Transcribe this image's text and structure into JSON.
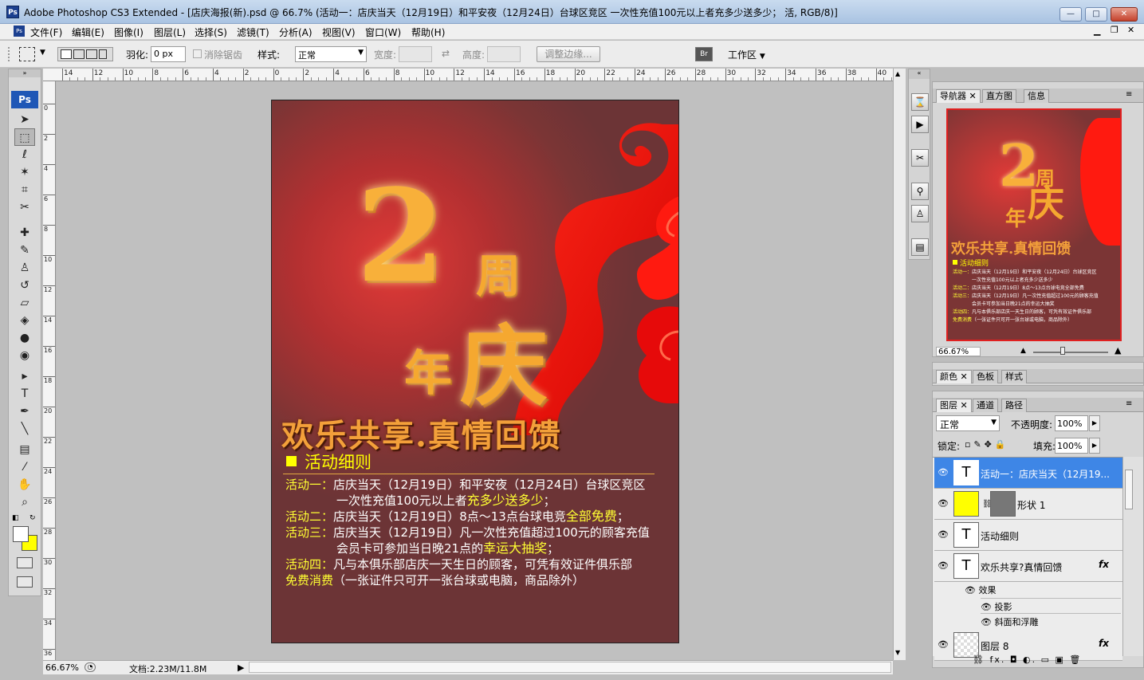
{
  "window": {
    "app_icon": "Ps",
    "title": "Adobe Photoshop CS3 Extended - [店庆海报(新).psd @ 66.7% (活动一：店庆当天（12月19日）和平安夜（12月24日）台球区竞区        一次性充值100元以上者充多少送多少； 活, RGB/8)]",
    "minimize": "—",
    "maximize": "□",
    "close": "✕"
  },
  "menubar": {
    "items": [
      "文件(F)",
      "编辑(E)",
      "图像(I)",
      "图层(L)",
      "选择(S)",
      "滤镜(T)",
      "分析(A)",
      "视图(V)",
      "窗口(W)",
      "帮助(H)"
    ],
    "doc_min": "▁",
    "doc_restore": "❐",
    "doc_close": "✕"
  },
  "options": {
    "feather_label": "羽化:",
    "feather_value": "0 px",
    "antialias_label": "消除锯齿",
    "style_label": "样式:",
    "style_value": "正常",
    "width_label": "宽度:",
    "height_label": "高度:",
    "refine_edge": "调整边缘...",
    "workspace": "工作区"
  },
  "toolbox": {
    "logo": "Ps",
    "tools": [
      {
        "name": "move-tool",
        "glyph": "➤"
      },
      {
        "name": "marquee-tool",
        "glyph": "⬚"
      },
      {
        "name": "lasso-tool",
        "glyph": "ℓ"
      },
      {
        "name": "magic-wand-tool",
        "glyph": "✶"
      },
      {
        "name": "crop-tool",
        "glyph": "⌗"
      },
      {
        "name": "slice-tool",
        "glyph": "✂"
      },
      {
        "name": "healing-brush-tool",
        "glyph": "✚"
      },
      {
        "name": "brush-tool",
        "glyph": "✎"
      },
      {
        "name": "clone-stamp-tool",
        "glyph": "♙"
      },
      {
        "name": "history-brush-tool",
        "glyph": "↺"
      },
      {
        "name": "eraser-tool",
        "glyph": "▱"
      },
      {
        "name": "paint-bucket-tool",
        "glyph": "◈"
      },
      {
        "name": "blur-tool",
        "glyph": "●"
      },
      {
        "name": "dodge-tool",
        "glyph": "◉"
      },
      {
        "name": "path-selection-tool",
        "glyph": "▸"
      },
      {
        "name": "type-tool",
        "glyph": "T"
      },
      {
        "name": "pen-tool",
        "glyph": "✒"
      },
      {
        "name": "line-tool",
        "glyph": "╲"
      },
      {
        "name": "notes-tool",
        "glyph": "▤"
      },
      {
        "name": "eyedropper-tool",
        "glyph": "⁄"
      },
      {
        "name": "hand-tool",
        "glyph": "✋"
      },
      {
        "name": "zoom-tool",
        "glyph": "⌕"
      }
    ]
  },
  "ruler_h": [
    "14",
    "12",
    "10",
    "8",
    "6",
    "4",
    "2",
    "0",
    "2",
    "4",
    "6",
    "8",
    "10",
    "12",
    "14",
    "16",
    "18",
    "20",
    "22",
    "24",
    "26",
    "28",
    "30",
    "32",
    "34",
    "36",
    "38",
    "40"
  ],
  "ruler_v": [
    "0",
    "2",
    "4",
    "6",
    "8",
    "10",
    "12",
    "14",
    "16",
    "18",
    "20",
    "22",
    "24",
    "26",
    "28",
    "30",
    "32",
    "34",
    "36"
  ],
  "status": {
    "zoom": "66.67%",
    "doc_info": "文档:2.23M/11.8M"
  },
  "poster": {
    "big_two": "2",
    "zhou": "周",
    "qing": "庆",
    "nian": "年",
    "slogan": "欢乐共享.真情回馈",
    "detail_title": "活动细则",
    "lines": [
      {
        "label": "活动一：",
        "text": "店庆当天（12月19日）和平安夜（12月24日）台球区竞区"
      },
      {
        "label": "",
        "text": "一次性充值100元以上者",
        "hl": "充多少送多少",
        "tail": "；"
      },
      {
        "label": "活动二：",
        "text": "店庆当天（12月19日）8点～13点台球电竞",
        "hl": "全部免费",
        "tail": "；"
      },
      {
        "label": "活动三：",
        "text": "店庆当天（12月19日）凡一次性充值超过100元的顾客充值"
      },
      {
        "label": "",
        "text": "会员卡可参加当日晚21点的",
        "hl": "幸运大抽奖",
        "tail": "；"
      },
      {
        "label": "活动四：",
        "text": "凡与本俱乐部店庆一天生日的顾客，可凭有效证件俱乐部"
      },
      {
        "label": "免费消费",
        "text": "（一张证件只可开一张台球或电脑，商品除外）"
      }
    ]
  },
  "navigator": {
    "tabs": [
      "导航器",
      "直方图",
      "信息"
    ],
    "zoom": "66.67%",
    "thumb_two": "2",
    "thumb_zhou": "周",
    "thumb_qing": "庆",
    "thumb_nian": "年",
    "thumb_slogan": "欢乐共享.真情回馈",
    "thumb_detail_title": "活动细则",
    "thumb_lines": [
      {
        "label": "活动一：",
        "text": "店庆当天（12月19日）和平安夜（12月24日）台球区竞区"
      },
      {
        "label": "",
        "text": "一次性充值100元以上者充多少送多少"
      },
      {
        "label": "活动二：",
        "text": "店庆当天（12月19日）8点～13点台球电竞全部免费"
      },
      {
        "label": "活动三：",
        "text": "店庆当天（12月19日）凡一次性充值超过100元的顾客充值"
      },
      {
        "label": "",
        "text": "会员卡可参加当日晚21点的幸运大抽奖"
      },
      {
        "label": "活动四：",
        "text": "凡与本俱乐部店庆一天生日的顾客，可凭有效证件俱乐部"
      },
      {
        "label": "免费消费",
        "text": "（一张证件只可开一张台球或电脑，商品除外）"
      }
    ]
  },
  "color_panel": {
    "tabs": [
      "颜色",
      "色板",
      "样式"
    ]
  },
  "layers_panel": {
    "tabs": [
      "图层",
      "通道",
      "路径"
    ],
    "blend_mode": "正常",
    "opacity_label": "不透明度:",
    "opacity_value": "100%",
    "lock_label": "锁定:",
    "fill_label": "填充:",
    "fill_value": "100%",
    "layers": [
      {
        "name": "活动一：店庆当天（12月19...",
        "type": "text",
        "selected": true,
        "fx": false
      },
      {
        "name": "形状 1",
        "type": "shape",
        "selected": false,
        "fx": false
      },
      {
        "name": "活动细则",
        "type": "text",
        "selected": false,
        "fx": false
      },
      {
        "name": "欢乐共享?真情回馈",
        "type": "text",
        "selected": false,
        "fx": true
      }
    ],
    "effects_label": "效果",
    "effect_items": [
      "投影",
      "斜面和浮雕"
    ],
    "last_layer": "图层 8",
    "fx": "fx",
    "bottom_icons": "⛓  fx.  ◘  ◐.  ▭  ▣  🗑"
  }
}
